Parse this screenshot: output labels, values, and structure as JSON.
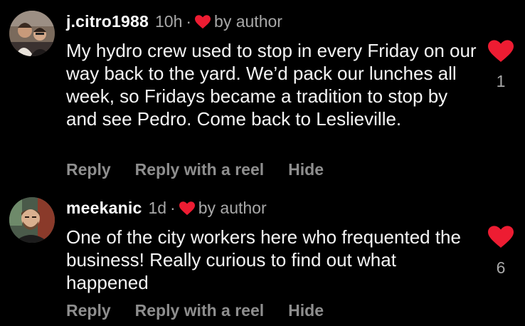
{
  "colors": {
    "background": "#000000",
    "text": "#f5f5f5",
    "muted": "#a8a8a8",
    "action": "#8e8e8e",
    "heart": "#ed1c32"
  },
  "comments": [
    {
      "username": "j.citro1988",
      "time": "10h",
      "separator": "·",
      "author_badge": "by author",
      "author_badge_icon": "heart-icon",
      "text": "My hydro crew used to stop in every Friday on our way back to the yard. We’d pack our lunches all week, so Fridays became a tradition to stop by and see Pedro. Come back to Leslieville.",
      "actions": {
        "reply": "Reply",
        "reply_reel": "Reply with a reel",
        "hide": "Hide"
      },
      "like_icon": "heart-filled-icon",
      "like_count": "1"
    },
    {
      "username": "meekanic",
      "time": "1d",
      "separator": "·",
      "author_badge": "by author",
      "author_badge_icon": "heart-icon",
      "text": "One of the city workers here who frequented the business! Really curious to find out what happened",
      "actions": {
        "reply": "Reply",
        "reply_reel": "Reply with a reel",
        "hide": "Hide"
      },
      "like_icon": "heart-filled-icon",
      "like_count": "6"
    }
  ]
}
